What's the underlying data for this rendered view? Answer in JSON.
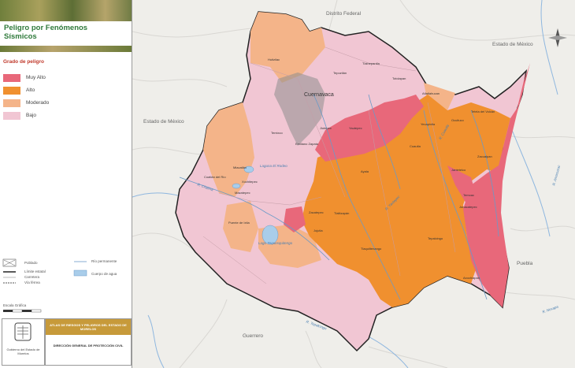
{
  "sidebar": {
    "title_line1": "Peligro por Fenómenos",
    "title_line2": "Sísmicos",
    "legend_heading": "Grado de peligro",
    "legend": [
      {
        "label": "Muy Alto",
        "color": "#e8687a"
      },
      {
        "label": "Alto",
        "color": "#f0902f"
      },
      {
        "label": "Moderado",
        "color": "#f4b489"
      },
      {
        "label": "Bajo",
        "color": "#f1c6d3"
      }
    ],
    "symbols": {
      "poblado": "Poblado",
      "limite": "Límite estatal",
      "carretera": "Carretera",
      "via": "Vía férrea",
      "rio": "Río permanente",
      "cuerpo": "Cuerpo de agua"
    },
    "scale_label": "Escala Gráfica",
    "footer_left": "Gobierno del Estado de Morelos",
    "footer_title": "ATLAS DE RIESGOS Y PELIGROS DEL ESTADO DE MORELOS",
    "footer_sub": "DIRECCIÓN GENERAL DE PROTECCIÓN CIVIL"
  },
  "map": {
    "states": {
      "df": "Distrito Federal",
      "edomex_ne": "Estado de México",
      "edomex_w": "Estado de México",
      "guerrero": "Guerrero",
      "puebla": "Puebla"
    },
    "capital": "Cuernavaca",
    "towns": [
      "Huitzilac",
      "Tepoztlán",
      "Tlalnepantla",
      "Totolapan",
      "Atlatlahucan",
      "Tetela del Volcán",
      "Ocuituco",
      "Yecapixtla",
      "Cuautla",
      "Ayala",
      "Temixco",
      "Emiliano Zapata",
      "Yautepec",
      "Jiutepec",
      "Miacatlán",
      "Coatlán del Río",
      "Mazatepec",
      "Puente de Ixtla",
      "Zacatepec",
      "Tlaltizapán",
      "Tlaquiltenango",
      "Jojutla",
      "Tepalcingo",
      "Jonacatepec",
      "Axochiapan",
      "Zacualpan",
      "Temoac",
      "Jantetelco",
      "Xochitepec"
    ],
    "rivers": [
      "R. Amacuzac",
      "R. Yautepec",
      "R. Cuautla",
      "R. Chalma",
      "Lago Tequesquitengo",
      "Laguna El Rodeo",
      "R. Nexapa",
      "R. Tepalcingo"
    ],
    "water": [
      "Tequesquitengo",
      "El Rodeo",
      "Coatetelco"
    ],
    "colors": {
      "muy_alto": "#e8687a",
      "alto": "#f0902f",
      "moderado": "#f4b489",
      "bajo": "#f1c6d3"
    }
  }
}
